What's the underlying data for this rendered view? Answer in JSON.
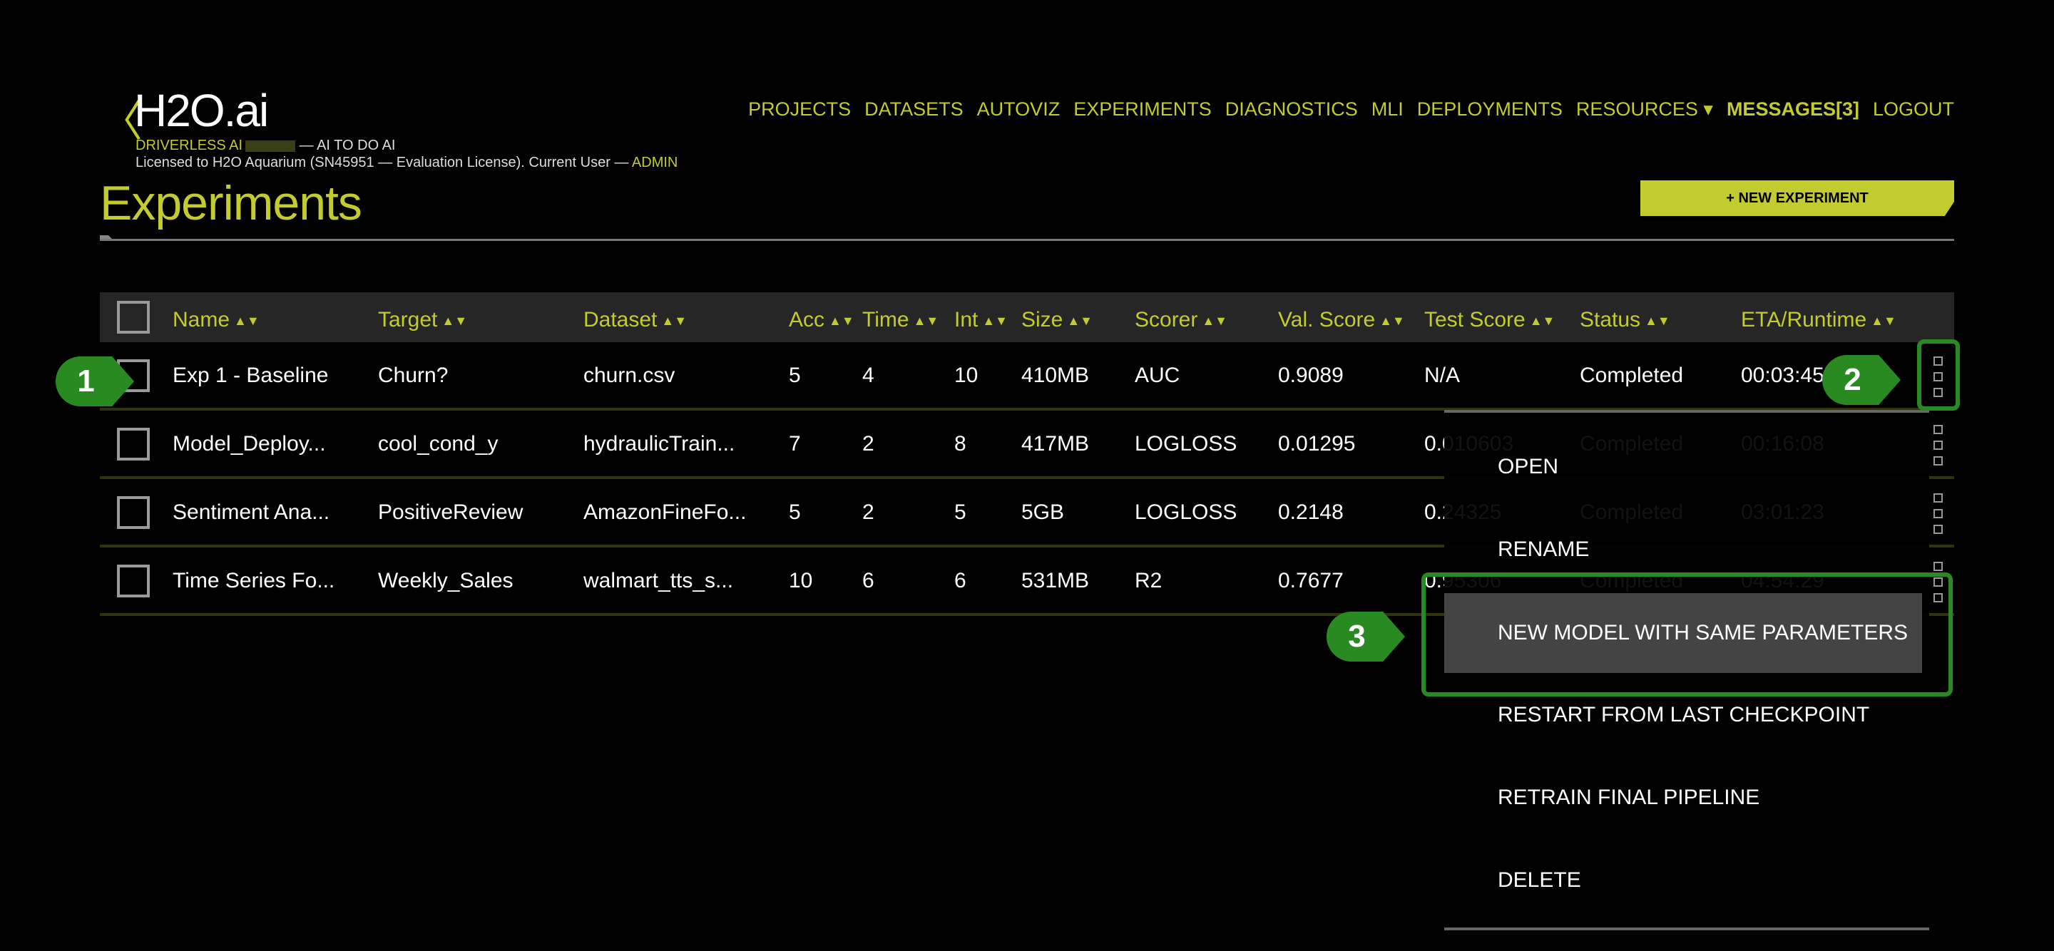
{
  "header": {
    "back_icon": "chevron-left-icon",
    "logo": "H2O.ai",
    "product": "DRIVERLESS AI",
    "tagline": " — AI TO DO AI",
    "license": "Licensed to H2O Aquarium (SN45951 — Evaluation License). Current User — ",
    "user": "ADMIN"
  },
  "nav": [
    "PROJECTS",
    "DATASETS",
    "AUTOVIZ",
    "EXPERIMENTS",
    "DIAGNOSTICS",
    "MLI",
    "DEPLOYMENTS",
    "RESOURCES ▾",
    "MESSAGES[3]",
    "LOGOUT"
  ],
  "page": {
    "title": "Experiments",
    "new_button": "+ NEW EXPERIMENT"
  },
  "table": {
    "columns": [
      "Name",
      "Target",
      "Dataset",
      "Acc",
      "Time",
      "Int",
      "Size",
      "Scorer",
      "Val. Score",
      "Test Score",
      "Status",
      "ETA/Runtime"
    ],
    "rows": [
      [
        "Exp 1 - Baseline",
        "Churn?",
        "churn.csv",
        "5",
        "4",
        "10",
        "410MB",
        "AUC",
        "0.9089",
        "N/A",
        "Completed",
        "00:03:45"
      ],
      [
        "Model_Deploy...",
        "cool_cond_y",
        "hydraulicTrain...",
        "7",
        "2",
        "8",
        "417MB",
        "LOGLOSS",
        "0.01295",
        "0.010603",
        "Completed",
        "00:16:08"
      ],
      [
        "Sentiment Ana...",
        "PositiveReview",
        "AmazonFineFo...",
        "5",
        "2",
        "5",
        "5GB",
        "LOGLOSS",
        "0.2148",
        "0.24325",
        "Completed",
        "03:01:23"
      ],
      [
        "Time Series Fo...",
        "Weekly_Sales",
        "walmart_tts_s...",
        "10",
        "6",
        "6",
        "531MB",
        "R2",
        "0.7677",
        "0.95306",
        "Completed",
        "04:54:29"
      ]
    ]
  },
  "menu": {
    "items": [
      "OPEN",
      "RENAME",
      "NEW MODEL WITH SAME PARAMETERS",
      "RESTART FROM LAST CHECKPOINT",
      "RETRAIN FINAL PIPELINE",
      "DELETE"
    ],
    "highlighted": "NEW MODEL WITH SAME PARAMETERS"
  },
  "callouts": [
    "1",
    "2",
    "3"
  ],
  "colors": {
    "accent": "#c2cc2e",
    "callout": "#2a8a22",
    "header_bg": "#262626",
    "highlight": "#444444"
  }
}
